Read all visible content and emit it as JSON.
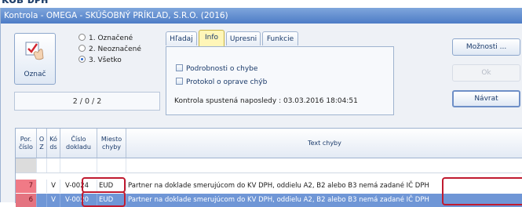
{
  "window": {
    "title": "Kontrola - OMEGA - SKÚŠOBNÝ PRÍKLAD, S.R.O. (2016)"
  },
  "mark_button": {
    "label": "Označ",
    "icon": "check-hand-icon"
  },
  "filter_options": [
    {
      "label": "1. Označené",
      "selected": false
    },
    {
      "label": "2. Neoznačené",
      "selected": false
    },
    {
      "label": "3. Všetko",
      "selected": true
    }
  ],
  "counter": "2 / 0 / 2",
  "tabs": [
    {
      "label": "Hľadaj",
      "active": false
    },
    {
      "label": "Info",
      "active": true
    },
    {
      "label": "Upresni",
      "active": false
    },
    {
      "label": "Funkcie",
      "active": false
    }
  ],
  "info_panel": {
    "checkboxes": [
      {
        "label": "Podrobnosti o chybe"
      },
      {
        "label": "Protokol o oprave chýb"
      }
    ],
    "last_run": "Kontrola spustená naposledy : 03.03.2016 18:04:51"
  },
  "side_buttons": [
    {
      "label": "Možnosti ...",
      "state": "normal"
    },
    {
      "label": "Ok",
      "state": "disabled"
    },
    {
      "label": "Návrat",
      "state": "focus"
    }
  ],
  "grid": {
    "columns": [
      {
        "label": "Por. číslo"
      },
      {
        "label": "O Z"
      },
      {
        "label": "Kó ds"
      },
      {
        "label": "Číslo dokladu"
      },
      {
        "label": "Miesto chyby"
      },
      {
        "label": "Text chyby"
      }
    ],
    "rows": [
      {
        "por": "7",
        "oz": "",
        "kods": "V",
        "cislo": "V-0024",
        "miesto": "EUD",
        "text": "Partner na doklade smerujúcom do KV DPH, oddielu A2, B2 alebo B3 nemá zadané IČ DPH",
        "selected": false
      },
      {
        "por": "6",
        "oz": "",
        "kods": "V",
        "cislo": "V-0020",
        "miesto": "EUD",
        "text": "Partner na doklade smerujúcom do KV DPH, oddielu A2, B2 alebo B3 nemá zadané IČ DPH",
        "selected": true
      }
    ]
  },
  "colors": {
    "titlebar": "#5a87cc",
    "active_tab": "#fff6b8",
    "selected_row": "#6f96d6",
    "error_cell": "#f07a86",
    "highlight": "#c01b30"
  }
}
